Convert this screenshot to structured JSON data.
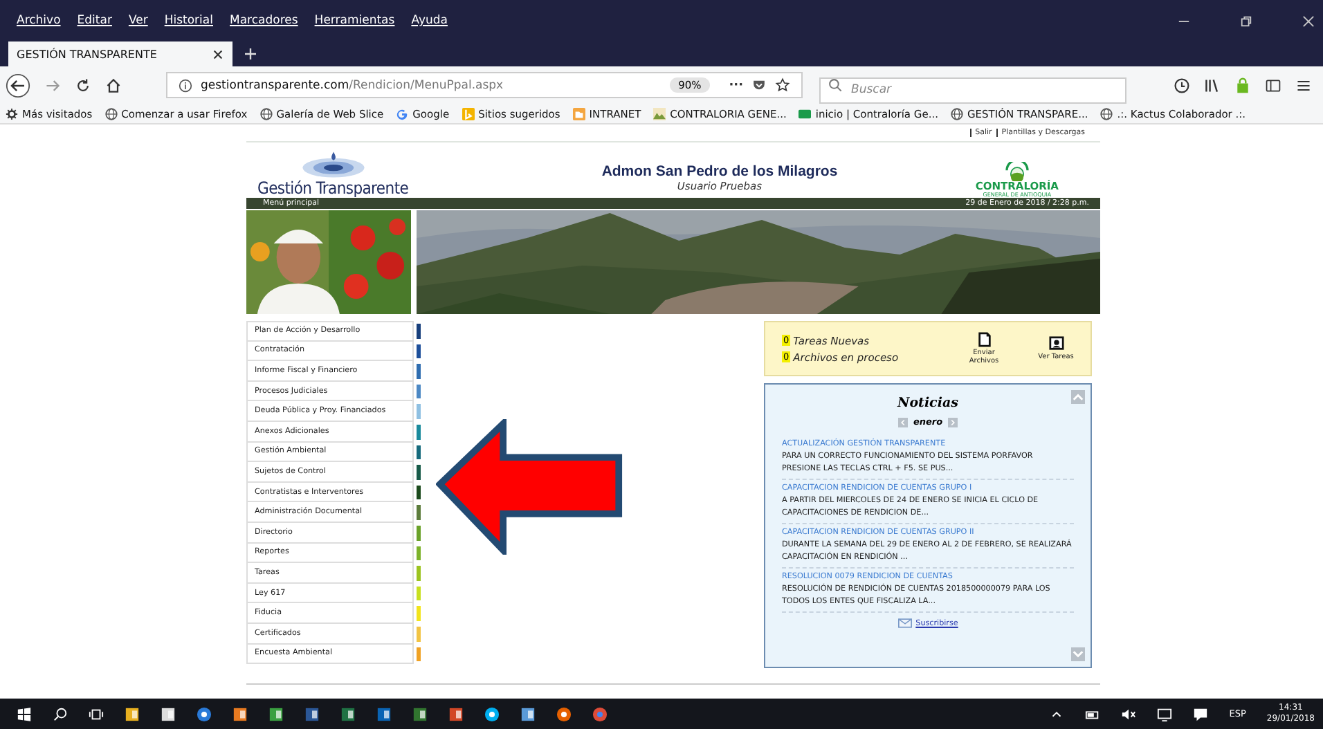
{
  "menu_bar": {
    "items": [
      "Archivo",
      "Editar",
      "Ver",
      "Historial",
      "Marcadores",
      "Herramientas",
      "Ayuda"
    ]
  },
  "tabs": [
    {
      "label": "GESTIÓN TRANSPARENTE",
      "selected": true
    }
  ],
  "address_bar": {
    "host": "gestiontransparente.com",
    "path": "/Rendicion/MenuPpal.aspx",
    "zoom": "90%",
    "menu": "···"
  },
  "search": {
    "placeholder": "Buscar"
  },
  "bookmarks": [
    {
      "label": "Más visitados",
      "kind": "gear"
    },
    {
      "label": "Comenzar a usar Firefox",
      "kind": "globe"
    },
    {
      "label": "Galería de Web Slice",
      "kind": "globe"
    },
    {
      "label": "Google",
      "kind": "google"
    },
    {
      "label": "Sitios sugeridos",
      "kind": "bing"
    },
    {
      "label": "INTRANET",
      "kind": "folder"
    },
    {
      "label": "CONTRALORIA GENE..."
    },
    {
      "label": "inicio | Contraloría Ge...",
      "kind": "badge"
    },
    {
      "label": "GESTIÓN TRANSPARE...",
      "kind": "globe"
    },
    {
      "label": ".:. Kactus Colaborador .:.",
      "kind": "globe"
    }
  ],
  "page": {
    "top_links": [
      "Salir",
      "Plantillas y Descargas"
    ],
    "logo_text": "Gestión Transparente",
    "entity": "Admon San Pedro de los Milagros",
    "user": "Usuario Pruebas",
    "agency": "CONTRALORÍA",
    "agency_sub": "GENERAL DE ANTIOQUIA",
    "menu_label": "Menú principal",
    "date": "29 de Enero de 2018 / 2:28 p.m.",
    "menu": [
      {
        "label": "Plan de Acción y Desarrollo",
        "color": "#173f7c"
      },
      {
        "label": "Contratación",
        "color": "#1d4f9a"
      },
      {
        "label": "Informe Fiscal y Financiero",
        "color": "#2f6db0"
      },
      {
        "label": "Procesos Judiciales",
        "color": "#4c88c4"
      },
      {
        "label": "Deuda Pública y Proy. Financiados",
        "color": "#8fc0e2"
      },
      {
        "label": "Anexos Adicionales",
        "color": "#1a8a9c"
      },
      {
        "label": "Gestión Ambiental",
        "color": "#166a7c"
      },
      {
        "label": "Sujetos de Control",
        "color": "#175a48"
      },
      {
        "label": "Contratistas e Interventores",
        "color": "#1b4a1c"
      },
      {
        "label": "Administración Documental",
        "color": "#5c7c3c"
      },
      {
        "label": "Directorio",
        "color": "#6aa22a"
      },
      {
        "label": "Reportes",
        "color": "#7cb22a"
      },
      {
        "label": "Tareas",
        "color": "#9cc420"
      },
      {
        "label": "Ley 617",
        "color": "#c8e020"
      },
      {
        "label": "Fiducia",
        "color": "#f2e41c"
      },
      {
        "label": "Certificados",
        "color": "#f2c444"
      },
      {
        "label": "Encuesta Ambiental",
        "color": "#f0a224"
      }
    ],
    "tasks": {
      "counts": [
        {
          "count": "0",
          "label": "Tareas Nuevas"
        },
        {
          "count": "0",
          "label": "Archivos en proceso"
        }
      ],
      "buttons": [
        {
          "label": "Enviar Archivos",
          "kind": "send"
        },
        {
          "label": "Ver Tareas",
          "kind": "view"
        }
      ]
    },
    "news": {
      "title": "Noticias",
      "month": "enero",
      "items": [
        {
          "title": "ACTUALIZACIÓN GESTIÓN TRANSPARENTE",
          "text": "PARA UN CORRECTO FUNCIONAMIENTO DEL SISTEMA PORFAVOR PRESIONE LAS TECLAS CTRL + F5. SE PUS..."
        },
        {
          "title": "CAPACITACION RENDICION DE CUENTAS GRUPO I",
          "text": "A PARTIR DEL MIERCOLES DE 24 DE ENERO SE INICIA EL CICLO DE CAPACITACIONES DE RENDICION DE..."
        },
        {
          "title": "CAPACITACION RENDICION DE CUENTAS GRUPO II",
          "text": "DURANTE LA SEMANA DEL 29 DE ENERO AL 2 DE FEBRERO, SE REALIZARÁ CAPACITACIÓN EN RENDICIÓN ..."
        },
        {
          "title": "RESOLUCION 0079 RENDICION DE CUENTAS",
          "text": "RESOLUCIÓN DE RENDICIÓN DE CUENTAS 2018500000079 PARA LOS TODOS LOS ENTES QUE FISCALIZA LA..."
        }
      ],
      "subscribe": "Suscribirse"
    }
  },
  "taskbar": {
    "apps": [
      {
        "kind": "folder"
      },
      {
        "kind": "store"
      },
      {
        "kind": "edge"
      },
      {
        "kind": "media"
      },
      {
        "kind": "chart"
      },
      {
        "kind": "word"
      },
      {
        "kind": "excel"
      },
      {
        "kind": "outlook"
      },
      {
        "kind": "project"
      },
      {
        "kind": "powerpoint"
      },
      {
        "kind": "skype"
      },
      {
        "kind": "screen"
      },
      {
        "kind": "firefox"
      },
      {
        "kind": "chrome"
      }
    ],
    "language": "ESP",
    "time": "14:31",
    "date": "29/01/2018"
  }
}
